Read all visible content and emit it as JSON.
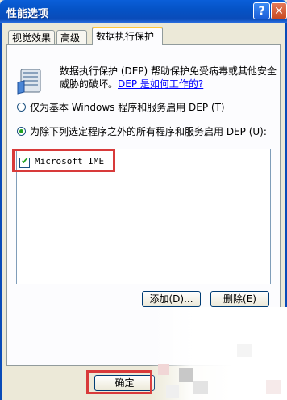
{
  "window": {
    "title": "性能选项",
    "help_label": "?",
    "close_label": "✕"
  },
  "tabs": [
    {
      "label": "视觉效果"
    },
    {
      "label": "高级"
    },
    {
      "label": "数据执行保护"
    }
  ],
  "dep": {
    "description_text": "数据执行保护 (DEP) 帮助保护免受病毒或其他安全威胁的破坏。",
    "link_text": "DEP 是如何工作的?",
    "option1_label": "仅为基本 Windows 程序和服务启用 DEP (T)",
    "option2_label": "为除下列选定程序之外的所有程序和服务启用 DEP (U):",
    "selected_option": 2,
    "programs": [
      {
        "name": "Microsoft IME",
        "checked": true
      }
    ],
    "add_button": "添加(D)...",
    "remove_button": "删除(E)"
  },
  "footer": {
    "ok_button": "确定"
  },
  "colors": {
    "titlebar": "#0a4bb8",
    "highlight_box": "#d83a3a",
    "link": "#0000ff",
    "dialog_bg": "#ece9d8"
  }
}
